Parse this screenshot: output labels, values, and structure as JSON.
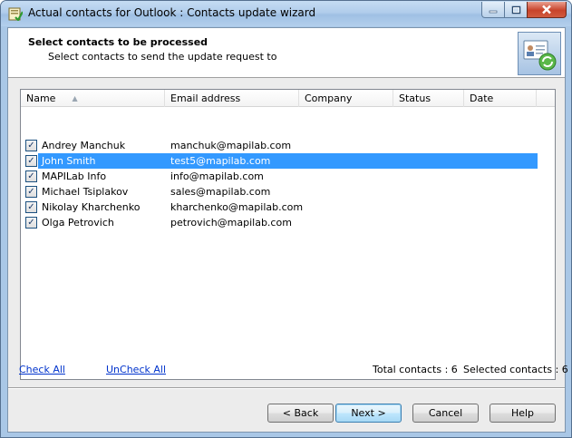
{
  "window": {
    "title": "Actual contacts for Outlook : Contacts update wizard"
  },
  "header": {
    "title": "Select contacts to be processed",
    "subtitle": "Select contacts to send the update request to",
    "icon": "contact-card-refresh-icon"
  },
  "list": {
    "columns": [
      "Name",
      "Email address",
      "Company",
      "Status",
      "Date"
    ],
    "sort_column": "Name",
    "rows": [
      {
        "name": "Andrey Manchuk",
        "email": "manchuk@mapilab.com",
        "company": "",
        "status": "",
        "date": "",
        "checked": true,
        "selected": false
      },
      {
        "name": "John Smith",
        "email": "test5@mapilab.com",
        "company": "",
        "status": "",
        "date": "",
        "checked": true,
        "selected": true
      },
      {
        "name": "MAPILab Info",
        "email": "info@mapilab.com",
        "company": "",
        "status": "",
        "date": "",
        "checked": true,
        "selected": false
      },
      {
        "name": "Michael Tsiplakov",
        "email": "sales@mapilab.com",
        "company": "",
        "status": "",
        "date": "",
        "checked": true,
        "selected": false
      },
      {
        "name": "Nikolay Kharchenko",
        "email": "kharchenko@mapilab.com",
        "company": "",
        "status": "",
        "date": "",
        "checked": true,
        "selected": false
      },
      {
        "name": "Olga Petrovich",
        "email": "petrovich@mapilab.com",
        "company": "",
        "status": "",
        "date": "",
        "checked": true,
        "selected": false
      }
    ]
  },
  "links": {
    "check_all": "Check All",
    "uncheck_all": "UnCheck All"
  },
  "stats": {
    "total": "Total contacts : 6",
    "selected": "Selected contacts : 6"
  },
  "buttons": {
    "back": "< Back",
    "next": "Next >",
    "cancel": "Cancel",
    "help": "Help"
  },
  "colors": {
    "selection": "#3399ff",
    "link": "#0033cc",
    "frame": "#a9c7e6"
  }
}
